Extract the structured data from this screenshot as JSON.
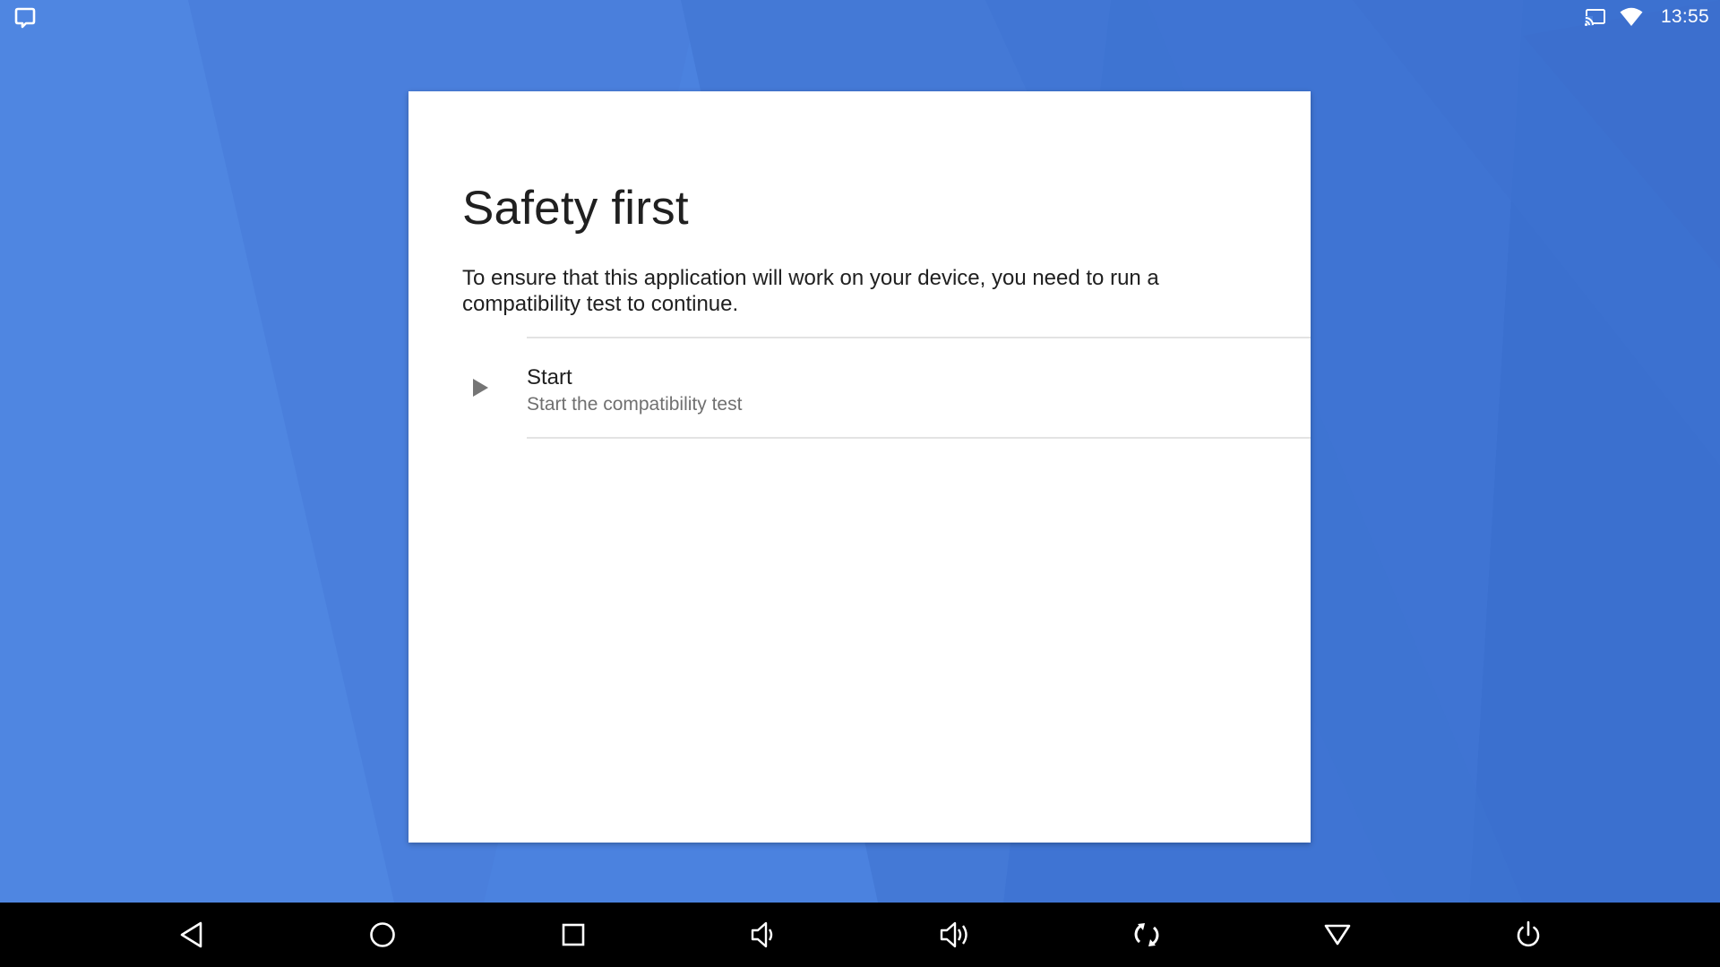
{
  "status_bar": {
    "left_icon": "notification-app-icon",
    "cast_icon": "cast-icon",
    "wifi_icon": "wifi-icon",
    "time": "13:55"
  },
  "dialog": {
    "title": "Safety first",
    "description": "To ensure that this application will work on your device, you need to run a compatibility test to continue.",
    "item": {
      "icon": "play-icon",
      "label": "Start",
      "sublabel": "Start the compatibility test"
    }
  },
  "nav_bar": {
    "buttons": [
      {
        "name": "back",
        "icon": "back-icon"
      },
      {
        "name": "home",
        "icon": "home-icon"
      },
      {
        "name": "recents",
        "icon": "recents-icon"
      },
      {
        "name": "volume-down",
        "icon": "volume-down-icon"
      },
      {
        "name": "volume-up",
        "icon": "volume-up-icon"
      },
      {
        "name": "rotate",
        "icon": "rotate-icon"
      },
      {
        "name": "menu",
        "icon": "triangle-down-icon"
      },
      {
        "name": "power",
        "icon": "power-icon"
      }
    ]
  },
  "colors": {
    "wallpaper": "#4a80dd",
    "dialog_bg": "#ffffff",
    "nav_bg": "#000000"
  }
}
